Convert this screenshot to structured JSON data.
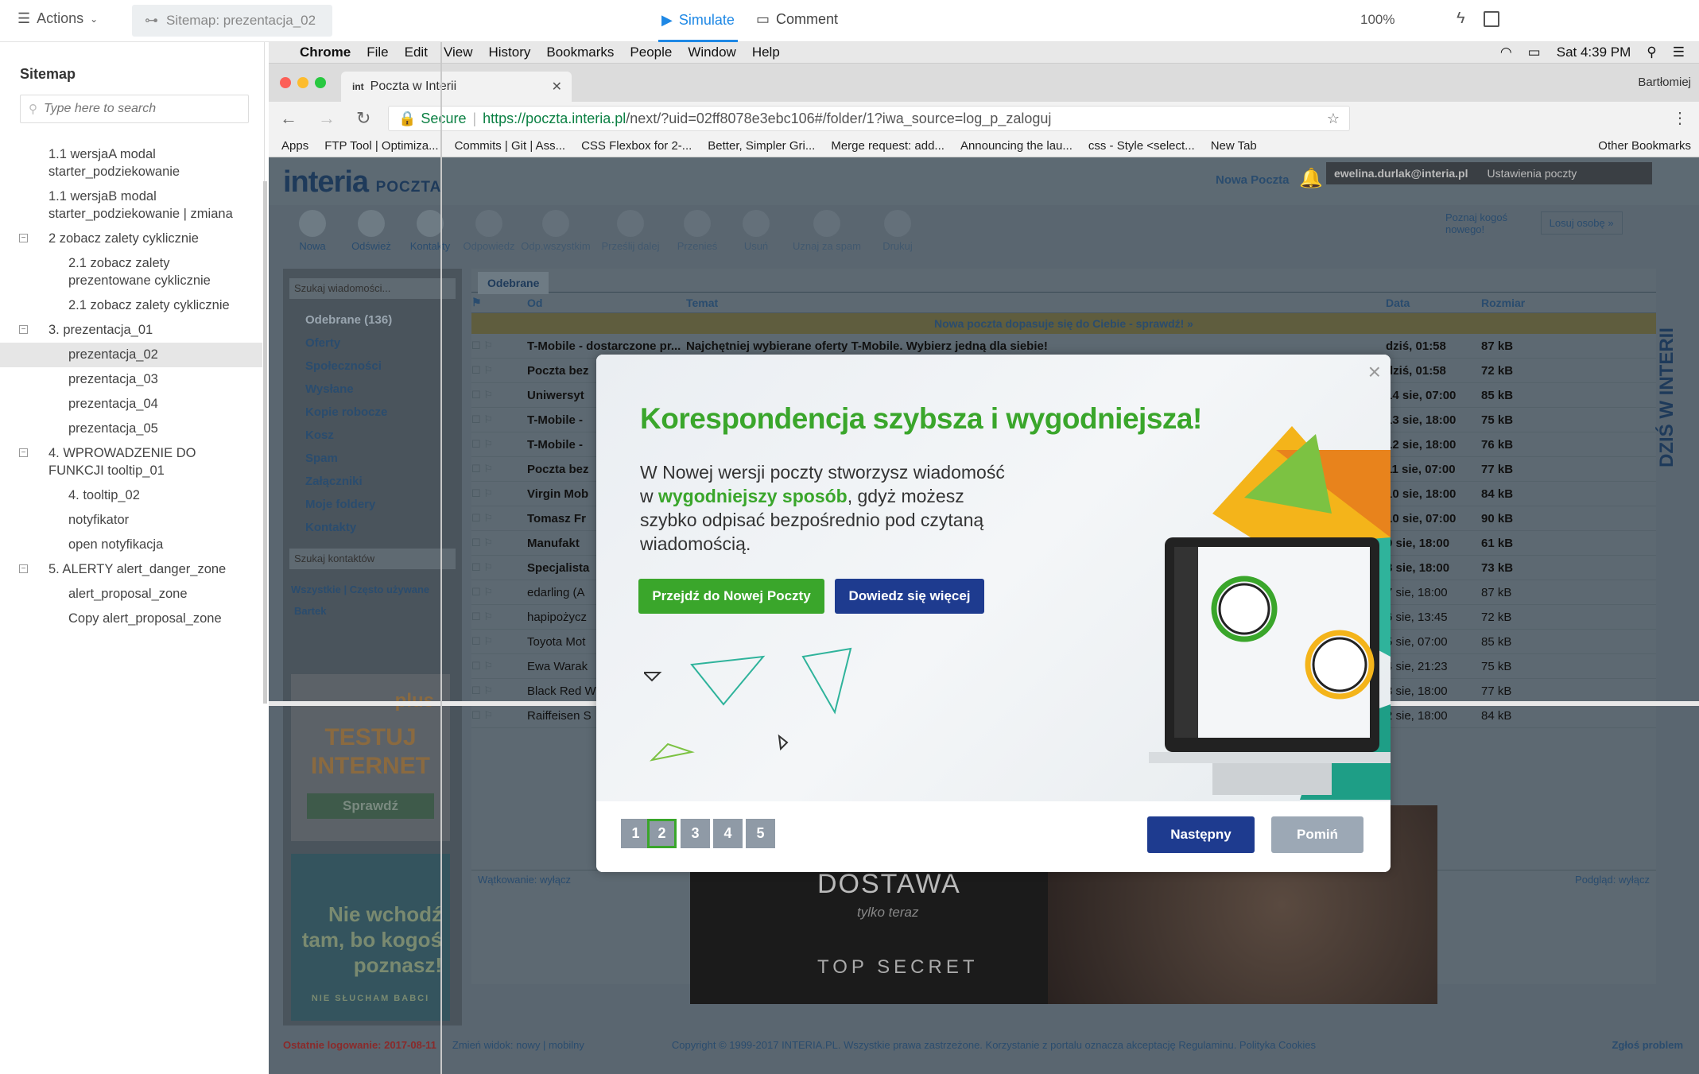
{
  "toolbar": {
    "actions_label": "Actions",
    "sitemap_tab_label": "Sitemap: prezentacja_02",
    "simulate_label": "Simulate",
    "comment_label": "Comment",
    "zoom": "100%"
  },
  "sidebar": {
    "title": "Sitemap",
    "search_placeholder": "Type here to search",
    "items": [
      {
        "label": "1.1 wersjaA modal starter_podziekowanie"
      },
      {
        "label": "1.1 wersjaB modal starter_podziekowanie | zmiana"
      },
      {
        "label": "2 zobacz zalety cyklicznie"
      },
      {
        "label": "2.1 zobacz zalety prezentowane cyklicznie"
      },
      {
        "label": "2.1 zobacz zalety cyklicznie"
      },
      {
        "label": "3. prezentacja_01"
      },
      {
        "label": "prezentacja_02"
      },
      {
        "label": "prezentacja_03"
      },
      {
        "label": "prezentacja_04"
      },
      {
        "label": "prezentacja_05"
      },
      {
        "label": "4. WPROWADZENIE DO FUNKCJI tooltip_01"
      },
      {
        "label": "4. tooltip_02"
      },
      {
        "label": "notyfikator"
      },
      {
        "label": "open notyfikacja"
      },
      {
        "label": "5. ALERTY alert_danger_zone"
      },
      {
        "label": "alert_proposal_zone"
      },
      {
        "label": "Copy alert_proposal_zone"
      }
    ]
  },
  "mac": {
    "app": "Chrome",
    "menu": [
      "File",
      "Edit",
      "View",
      "History",
      "Bookmarks",
      "People",
      "Window",
      "Help"
    ],
    "clock": "Sat 4:39 PM"
  },
  "browser": {
    "tab_title": "Poczta w Interii",
    "user": "Bartłomiej",
    "secure": "Secure",
    "url_host": "https://poczta.interia.pl",
    "url_path": "/next/?uid=02ff8078e3ebc106#/folder/1?iwa_source=log_p_zaloguj",
    "bookmarks": [
      "Apps",
      "FTP Tool | Optimiza...",
      "Commits | Git | Ass...",
      "CSS Flexbox for 2-...",
      "Better, Simpler Gri...",
      "Merge request: add...",
      "Announcing the lau...",
      "css - Style <select...",
      "New Tab",
      "Other Bookmarks"
    ]
  },
  "mail": {
    "logo": "interia",
    "logo_sub": "POCZTA",
    "nowa_poczta": "Nowa Poczta",
    "email": "ewelina.durlak@interia.pl",
    "settings": "Ustawienia poczty",
    "tools": [
      "Nowa",
      "Odśwież",
      "Kontakty",
      "Odpowiedz",
      "Odp.wszystkim",
      "Prześlij dalej",
      "Przenieś",
      "Usuń",
      "Uznaj za spam",
      "Drukuj"
    ],
    "promo_text": "Poznaj kogoś nowego!",
    "promo_btn": "Losuj osobę »",
    "search_placeholder": "Szukaj wiadomości...",
    "folders": [
      "Odebrane (136)",
      "Oferty",
      "Społeczności",
      "Wysłane",
      "Kopie robocze",
      "Kosz",
      "Spam",
      "Załączniki",
      "Moje foldery",
      "Kontakty"
    ],
    "contacts_search": "Szukaj kontaktów",
    "contacts_filter": "Wszystkie | Często używane",
    "contact": "Bartek",
    "tab": "Odebrane",
    "col_from": "Od",
    "col_subject": "Temat",
    "col_date": "Data",
    "col_size": "Rozmiar",
    "notice": "Nowa poczta dopasuje się do Ciebie - sprawdź! »",
    "rows": [
      {
        "from": "T-Mobile - dostarczone pr...",
        "subject": "Najchętniej wybierane oferty T-Mobile. Wybierz jedną dla siebie!",
        "date": "dziś, 01:58",
        "size": "87 kB",
        "read": false
      },
      {
        "from": "Poczta bez",
        "subject": "",
        "date": "dziś, 01:58",
        "size": "72 kB",
        "read": false
      },
      {
        "from": "Uniwersyt",
        "subject": "",
        "date": "14 sie, 07:00",
        "size": "85 kB",
        "read": false
      },
      {
        "from": "T-Mobile -",
        "subject": "",
        "date": "13 sie, 18:00",
        "size": "75 kB",
        "read": false
      },
      {
        "from": "T-Mobile -",
        "subject": "",
        "date": "12 sie, 18:00",
        "size": "76 kB",
        "read": false
      },
      {
        "from": "Poczta bez",
        "subject": "",
        "date": "11 sie, 07:00",
        "size": "77 kB",
        "read": false
      },
      {
        "from": "Virgin Mob",
        "subject": "",
        "date": "10 sie, 18:00",
        "size": "84 kB",
        "read": false
      },
      {
        "from": "Tomasz Fr",
        "subject": "",
        "date": "10 sie, 07:00",
        "size": "90 kB",
        "read": false
      },
      {
        "from": "Manufakt",
        "subject": "",
        "date": "9 sie, 18:00",
        "size": "61 kB",
        "read": false
      },
      {
        "from": "Specjalista",
        "subject": "",
        "date": "8 sie, 18:00",
        "size": "73 kB",
        "read": false
      },
      {
        "from": "edarling (A",
        "subject": "",
        "date": "7 sie, 18:00",
        "size": "87 kB",
        "read": true
      },
      {
        "from": "hapipożycz",
        "subject": "",
        "date": "6 sie, 13:45",
        "size": "72 kB",
        "read": true
      },
      {
        "from": "Toyota Mot",
        "subject": "",
        "date": "5 sie, 07:00",
        "size": "85 kB",
        "read": true
      },
      {
        "from": "Ewa Warak",
        "subject": "",
        "date": "4 sie, 21:23",
        "size": "75 kB",
        "read": true
      },
      {
        "from": "Black Red W",
        "subject": "",
        "date": "3 sie, 18:00",
        "size": "77 kB",
        "read": true
      },
      {
        "from": "Raiffeisen S",
        "subject": "",
        "date": "2 sie, 18:00",
        "size": "84 kB",
        "read": true
      }
    ],
    "threading": "Wątkowanie: wyłącz",
    "preview": "Podgląd: wyłącz",
    "ad1_brand": "plus",
    "ad1_text": "TESTUJ INTERNET",
    "ad1_btn": "Sprawdź",
    "ad2_text": "Nie wchodź tam, bo kogoś poznasz!",
    "ad2_footer": "NIE SŁUCHAM BABCI",
    "bigad_dostawa": "DOSTAWA",
    "bigad_teraz": "tylko teraz",
    "bigad_secret": "TOP SECRET",
    "vertical_ad": "DZIŚ W INTERII",
    "footer_last": "Ostatnie logowanie: 2017-08-11",
    "footer_view": "Zmień widok: nowy | mobilny",
    "footer_copy": "Copyright © 1999-2017 INTERIA.PL. Wszystkie prawa zastrzeżone. Korzystanie z portalu oznacza akceptację Regulaminu. Polityka Cookies",
    "footer_report": "Zgłoś problem"
  },
  "modal": {
    "title": "Korespondencja szybsza i wygodniejsza!",
    "desc_before": "W Nowej wersji poczty stworzysz wiadomość w ",
    "desc_highlight": "wygodniejszy sposób",
    "desc_after": ", gdyż możesz szybko odpisać bezpośrednio pod czytaną wiadomością.",
    "btn_go": "Przejdź do Nowej Poczty",
    "btn_more": "Dowiedz się więcej",
    "pages": [
      "1",
      "2",
      "3",
      "4",
      "5"
    ],
    "active_page": 2,
    "btn_next": "Następny",
    "btn_skip": "Pomiń",
    "green": "#3aa62b",
    "navy": "#1e3b8f"
  }
}
